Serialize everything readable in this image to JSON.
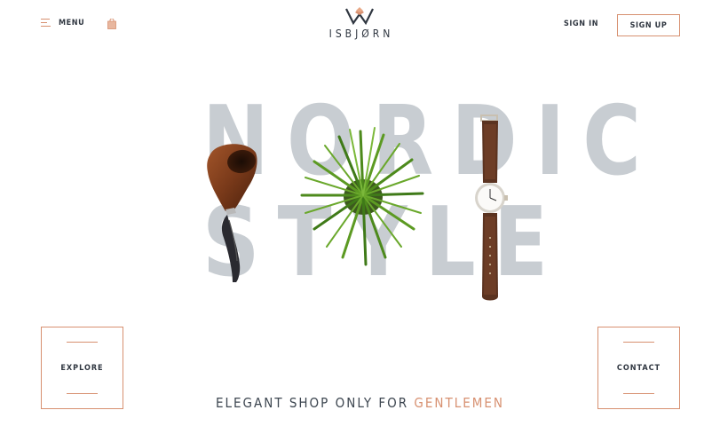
{
  "header": {
    "menu_label": "MENU",
    "menu_icon": "hamburger-icon",
    "bag_icon": "shopping-bag-icon",
    "logo_text": "ISBJØRN",
    "logo_icon": "bear-mountain-logo-icon",
    "signin_label": "SIGN IN",
    "signup_label": "SIGN UP"
  },
  "hero": {
    "word1": "NORDIC",
    "word2": "STYLE"
  },
  "actions": {
    "explore_label": "EXPLORE",
    "contact_label": "CONTACT"
  },
  "tagline": {
    "text": "ELEGANT SHOP ONLY FOR ",
    "accent": "GENTLEMEN"
  },
  "colors": {
    "accent": "#d79070",
    "text": "#2f3640",
    "hero_text": "#c8cdd2",
    "background": "#ffffff"
  }
}
